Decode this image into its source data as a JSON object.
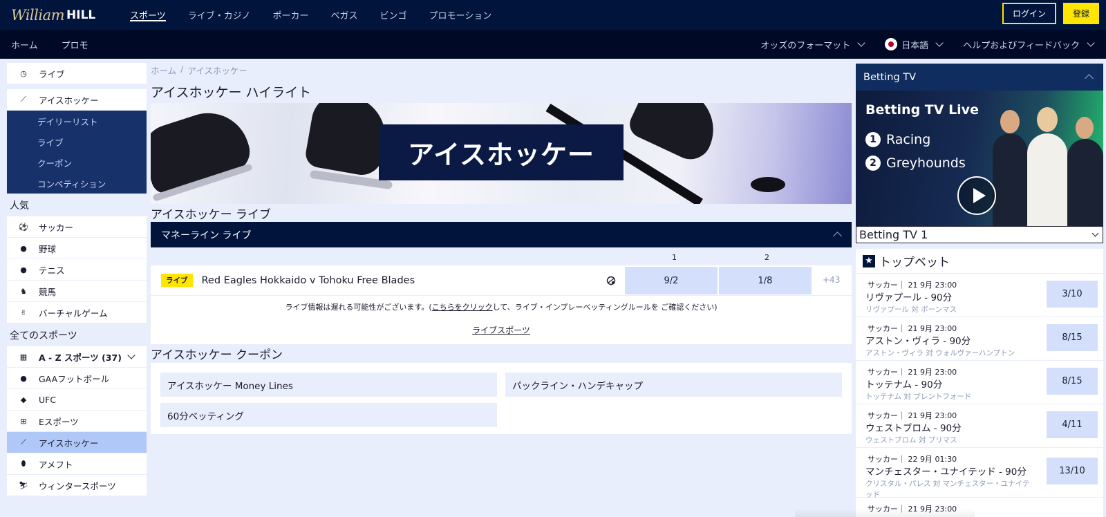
{
  "logo": {
    "script": "William",
    "bold": "HILL"
  },
  "topnav": {
    "items": [
      "スポーツ",
      "ライブ・カジノ",
      "ポーカー",
      "ベガス",
      "ビンゴ",
      "プロモーション"
    ],
    "login": "ログイン",
    "register": "登録"
  },
  "subnav": {
    "home": "ホーム",
    "promo": "プロモ",
    "odds_format": "オッズのフォーマット",
    "language": "日本語",
    "help": "ヘルプおよびフィードバック"
  },
  "sidebar": {
    "live": "ライブ",
    "icehockey": "アイスホッケー",
    "sub": [
      "デイリーリスト",
      "ライブ",
      "クーポン",
      "コンペティション"
    ],
    "popular_head": "人気",
    "popular": [
      "サッカー",
      "野球",
      "テニス",
      "競馬",
      "バーチャルゲーム"
    ],
    "all_head": "全てのスポーツ",
    "az": "A - Z スポーツ (37)",
    "all": [
      "GAAフットボール",
      "UFC",
      "Eスポーツ",
      "アイスホッケー",
      "アメフト",
      "ウィンタースポーツ"
    ]
  },
  "main": {
    "breadcrumb": [
      "ホーム",
      "アイスホッケー"
    ],
    "title": "アイスホッケー ハイライト",
    "banner_text": "アイスホッケー",
    "live_section": "アイスホッケー ライブ",
    "panel_title": "マネーライン ライブ",
    "col1": "1",
    "col2": "2",
    "match": {
      "badge": "ライブ",
      "name": "Red Eagles Hokkaido v Tohoku Free Blades",
      "odds1": "9/2",
      "odds2": "1/8",
      "more": "+43"
    },
    "info_pre": "ライブ情報は遅れる可能性がございます。(",
    "info_link": "こちらをクリック",
    "info_post": "して、ライブ・インプレーベッティングルールを ご確認ください)",
    "live_sports_link": "ライブスポーツ",
    "coupon_section": "アイスホッケー クーポン",
    "coupons": [
      "アイスホッケー Money Lines",
      "パックライン・ハンデキャップ",
      "60分ベッティング"
    ]
  },
  "tv": {
    "head": "Betting TV",
    "video_title": "Betting TV Live",
    "rows": [
      {
        "n": "1",
        "label": "Racing"
      },
      {
        "n": "2",
        "label": "Greyhounds"
      }
    ],
    "select": "Betting TV 1"
  },
  "topbets": {
    "head": "トップベット",
    "items": [
      {
        "meta": "サッカー｜ 21 9月 23:00",
        "selection": "リヴァプール - 90分",
        "event": "リヴァプール 対 ボーンマス",
        "price": "3/10"
      },
      {
        "meta": "サッカー｜ 21 9月 23:00",
        "selection": "アストン・ヴィラ - 90分",
        "event": "アストン・ヴィラ 対 ウォルヴァーハンプトン",
        "price": "8/15"
      },
      {
        "meta": "サッカー｜ 21 9月 23:00",
        "selection": "トッテナム - 90分",
        "event": "トッテナム 対 ブレントフォード",
        "price": "8/15"
      },
      {
        "meta": "サッカー｜ 21 9月 23:00",
        "selection": "ウェストブロム - 90分",
        "event": "ウェストブロム 対 プリマス",
        "price": "4/11"
      },
      {
        "meta": "サッカー｜ 22 9月 01:30",
        "selection": "マンチェスター・ユナイテッド - 90分",
        "event": "クリスタル・パレス 対 マンチェスター・ユナイテッド",
        "price": "13/10"
      },
      {
        "meta": "サッカー｜ 21 9月 23:00",
        "selection": "",
        "event": "",
        "price": ""
      }
    ]
  },
  "colors": {
    "navy": "#00143c",
    "yellow": "#ffe500",
    "odds_bg": "#d4e0fb",
    "selected": "#b0c8f7"
  }
}
